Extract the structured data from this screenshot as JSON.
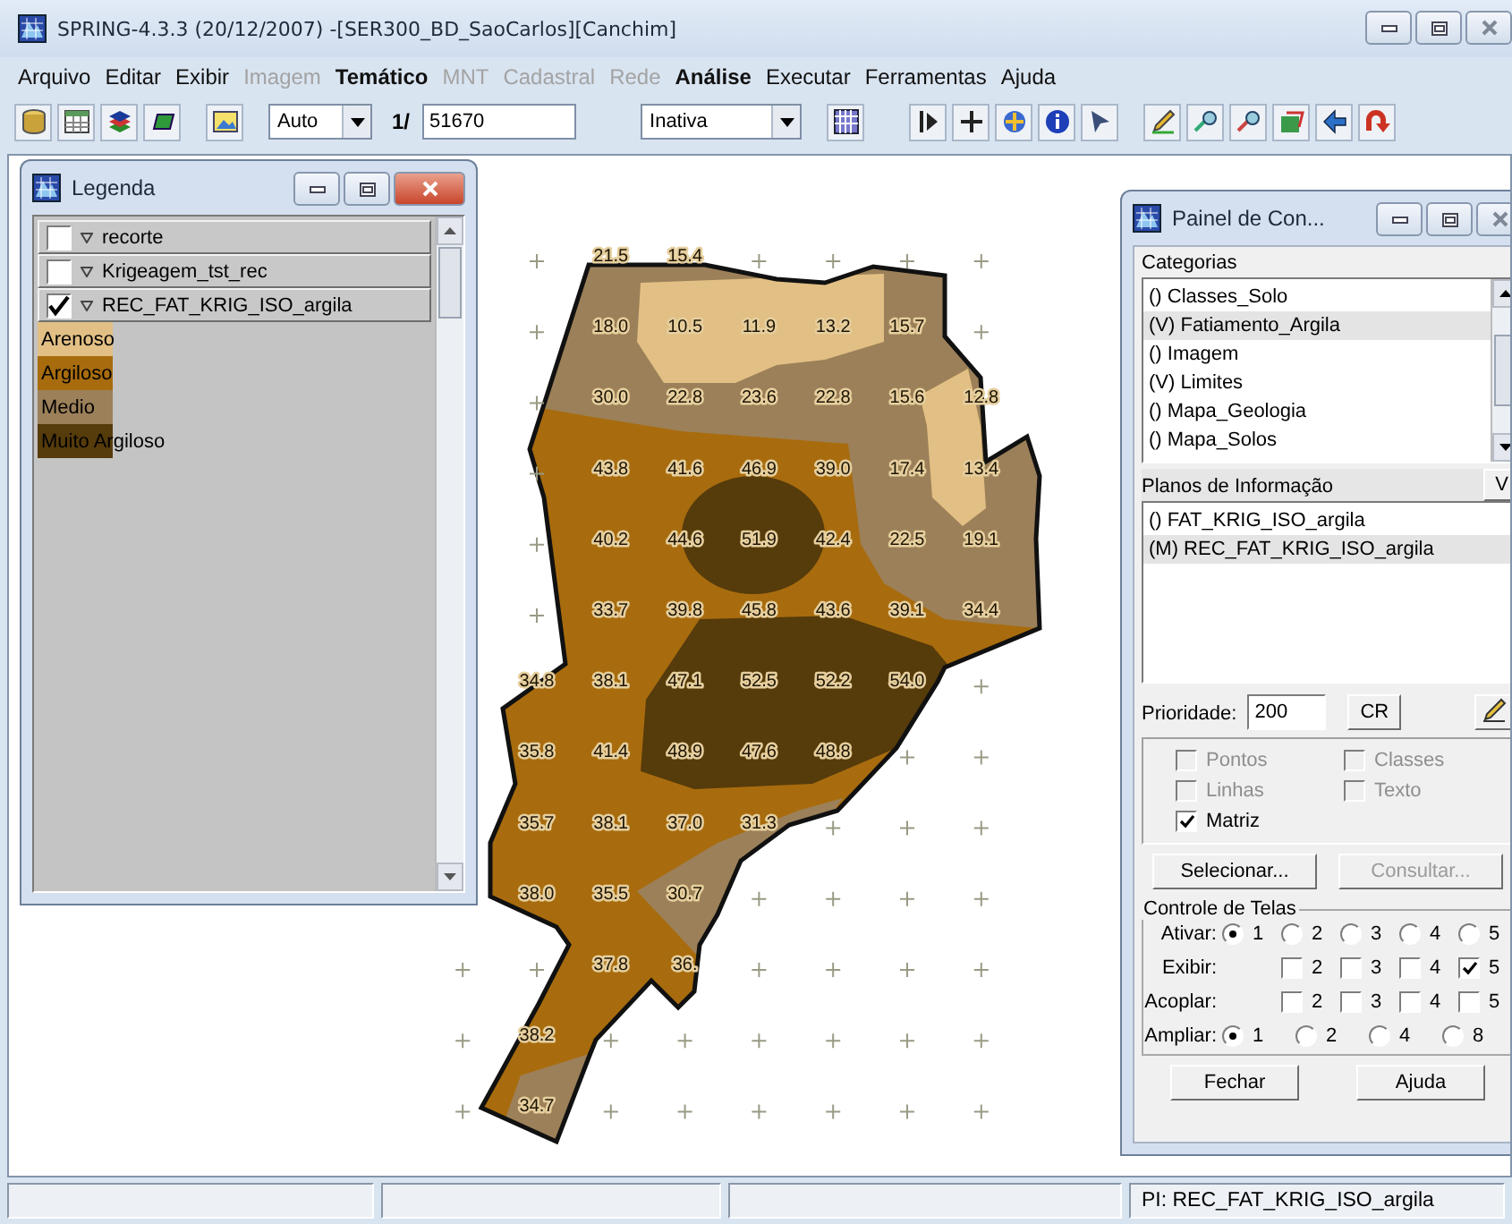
{
  "window": {
    "title": "SPRING-4.3.3 (20/12/2007) -[SER300_BD_SaoCarlos][Canchim]"
  },
  "menu": [
    {
      "label": "Arquivo",
      "disabled": false,
      "bold": false
    },
    {
      "label": "Editar",
      "disabled": false,
      "bold": false
    },
    {
      "label": "Exibir",
      "disabled": false,
      "bold": false
    },
    {
      "label": "Imagem",
      "disabled": true,
      "bold": false
    },
    {
      "label": "Temático",
      "disabled": false,
      "bold": true
    },
    {
      "label": "MNT",
      "disabled": true,
      "bold": false
    },
    {
      "label": "Cadastral",
      "disabled": true,
      "bold": false
    },
    {
      "label": "Rede",
      "disabled": true,
      "bold": false
    },
    {
      "label": "Análise",
      "disabled": false,
      "bold": true
    },
    {
      "label": "Executar",
      "disabled": false,
      "bold": false
    },
    {
      "label": "Ferramentas",
      "disabled": false,
      "bold": false
    },
    {
      "label": "Ajuda",
      "disabled": false,
      "bold": false
    }
  ],
  "toolbar": {
    "scale_mode": "Auto",
    "scale_prefix": "1/",
    "scale": "51670",
    "cursor_mode": "Inativa"
  },
  "map": {
    "grid": [
      {
        "column_3": "21.5",
        "column_4": "15.4"
      },
      {
        "column_3": "18.0",
        "column_4": "10.5",
        "column_5": "11.9",
        "column_6": "13.2",
        "column_7": "15.7"
      },
      {
        "column_3": "30.0",
        "column_4": "22.8",
        "column_5": "23.6",
        "column_6": "22.8",
        "column_7": "15.6",
        "column_8": "12.8"
      },
      {
        "column_3": "43.8",
        "column_4": "41.6",
        "column_5": "46.9",
        "column_6": "39.0",
        "column_7": "17.4",
        "column_8": "13.4"
      },
      {
        "column_3": "40.2",
        "column_4": "44.6",
        "column_5": "51.9",
        "column_6": "42.4",
        "column_7": "22.5",
        "column_8": "19.1"
      },
      {
        "column_3": "33.7",
        "column_4": "39.8",
        "column_5": "45.8",
        "column_6": "43.6",
        "column_7": "39.1",
        "column_8": "34.4"
      },
      {
        "column_2": "34.8",
        "column_3": "38.1",
        "column_4": "47.1",
        "column_5": "52.5",
        "column_6": "52.2",
        "column_7": "54.0"
      },
      {
        "column_2": "35.8",
        "column_3": "41.4",
        "column_4": "48.9",
        "column_5": "47.6",
        "column_6": "48.8"
      },
      {
        "column_2": "35.7",
        "column_3": "38.1",
        "column_4": "37.0",
        "column_5": "31.3"
      },
      {
        "column_2": "38.0",
        "column_3": "35.5",
        "column_4": "30.7"
      },
      {
        "column_3": "37.8",
        "column_4": "36."
      },
      {
        "column_2": "38.2"
      },
      {
        "column_2": "34.7"
      }
    ]
  },
  "legend": {
    "title": "Legenda",
    "layers": [
      {
        "name": "recorte",
        "checked": false
      },
      {
        "name": "Krigeagem_tst_rec",
        "checked": false
      },
      {
        "name": "REC_FAT_KRIG_ISO_argila",
        "checked": true,
        "classes": [
          {
            "name": "Arenoso",
            "color": "#e2bf84"
          },
          {
            "name": "Argiloso",
            "color": "#a86c0e"
          },
          {
            "name": "Medio",
            "color": "#9c8059"
          },
          {
            "name": "Muito Argiloso",
            "color": "#563b0b"
          }
        ]
      }
    ]
  },
  "control_panel": {
    "title": "Painel de Con...",
    "categories_label": "Categorias",
    "categories": [
      {
        "label": "() Classes_Solo",
        "selected": false
      },
      {
        "label": "(V) Fatiamento_Argila",
        "selected": true
      },
      {
        "label": "() Imagem",
        "selected": false
      },
      {
        "label": "(V) Limites",
        "selected": false
      },
      {
        "label": "() Mapa_Geologia",
        "selected": false
      },
      {
        "label": "() Mapa_Solos",
        "selected": false
      }
    ],
    "planes_label": "Planos de Informação",
    "planes_button": "V",
    "planes": [
      {
        "label": "() FAT_KRIG_ISO_argila",
        "selected": false
      },
      {
        "label": "(M) REC_FAT_KRIG_ISO_argila",
        "selected": true
      }
    ],
    "priority_label": "Prioridade:",
    "priority": "200",
    "cr_button": "CR",
    "representations": [
      {
        "label": "Pontos",
        "checked": false,
        "disabled": true
      },
      {
        "label": "Classes",
        "checked": false,
        "disabled": true
      },
      {
        "label": "Linhas",
        "checked": false,
        "disabled": true
      },
      {
        "label": "Texto",
        "checked": false,
        "disabled": true
      },
      {
        "label": "Matriz",
        "checked": true,
        "disabled": false
      }
    ],
    "select_button": {
      "label": "Selecionar...",
      "disabled": false
    },
    "query_button": {
      "label": "Consultar...",
      "disabled": true
    },
    "screens": {
      "title": "Controle de Telas",
      "rows": [
        {
          "label": "Ativar:",
          "kind": "radio",
          "options": [
            {
              "label": "1",
              "selected": true
            },
            {
              "label": "2",
              "selected": false
            },
            {
              "label": "3",
              "selected": false
            },
            {
              "label": "4",
              "selected": false
            },
            {
              "label": "5",
              "selected": false
            }
          ]
        },
        {
          "label": "Exibir:",
          "kind": "checkbox",
          "options": [
            {
              "label": "2",
              "checked": false
            },
            {
              "label": "3",
              "checked": false
            },
            {
              "label": "4",
              "checked": false
            },
            {
              "label": "5",
              "checked": true
            }
          ]
        },
        {
          "label": "Acoplar:",
          "kind": "checkbox",
          "options": [
            {
              "label": "2",
              "checked": false
            },
            {
              "label": "3",
              "checked": false
            },
            {
              "label": "4",
              "checked": false
            },
            {
              "label": "5",
              "checked": false
            }
          ]
        },
        {
          "label": "Ampliar:",
          "kind": "radio",
          "options": [
            {
              "label": "1",
              "selected": true
            },
            {
              "label": "2",
              "selected": false
            },
            {
              "label": "4",
              "selected": false
            },
            {
              "label": "8",
              "selected": false
            }
          ]
        }
      ]
    },
    "close_button": "Fechar",
    "help_button": "Ajuda"
  },
  "status_bar": {
    "text": "PI: REC_FAT_KRIG_ISO_argila"
  }
}
